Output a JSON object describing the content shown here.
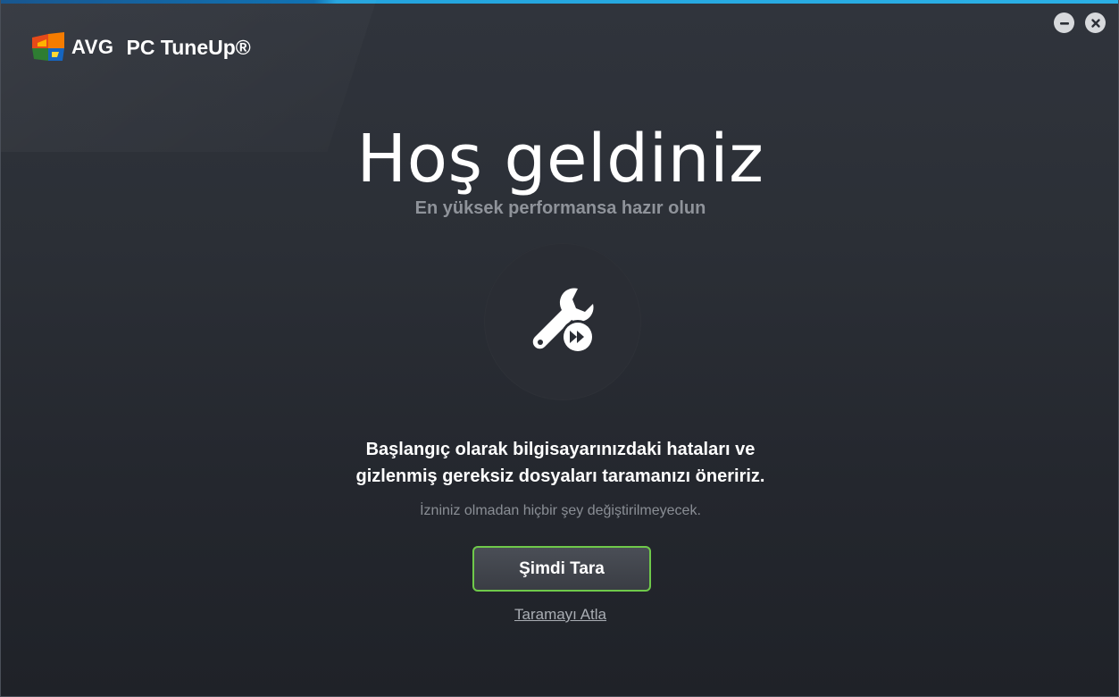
{
  "app": {
    "brand": "AVG",
    "product": "PC TuneUp®"
  },
  "window_controls": {
    "minimize_icon": "minimize-icon",
    "close_icon": "close-icon"
  },
  "welcome": {
    "title": "Hoş geldiniz",
    "subtitle": "En yüksek performansa hazır olun",
    "hero_icon": "wrench-fast-forward-icon",
    "message_line1": "Başlangıç olarak bilgisayarınızdaki hataları ve",
    "message_line2": "gizlenmiş gereksiz dosyaları taramanızı öneririz.",
    "note": "İzniniz olmadan hiçbir şey değiştirilmeyecek.",
    "scan_button": "Şimdi Tara",
    "skip_link": "Taramayı Atla"
  },
  "colors": {
    "accent_top_bar": "#2bb0e6",
    "button_border": "#6fc94a",
    "background": "#2b2f36"
  }
}
